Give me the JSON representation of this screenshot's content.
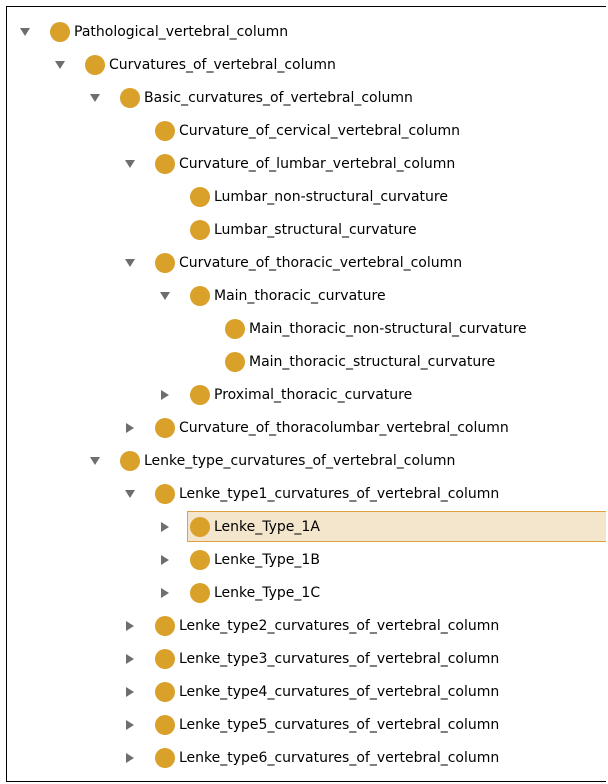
{
  "tree": {
    "colors": {
      "class_dot": "#d9a02a",
      "toggle_arrow": "#6e6e6e",
      "selection_fill": "#f4e6cc",
      "selection_border": "#e0a040"
    },
    "nodes": [
      {
        "label": "Pathological_vertebral_column",
        "depth": 0,
        "toggle": "expanded",
        "icon": "class-circle-icon"
      },
      {
        "label": "Curvatures_of_vertebral_column",
        "depth": 1,
        "toggle": "expanded",
        "icon": "class-circle-icon"
      },
      {
        "label": "Basic_curvatures_of_vertebral_column",
        "depth": 2,
        "toggle": "expanded",
        "icon": "class-circle-icon"
      },
      {
        "label": "Curvature_of_cervical_vertebral_column",
        "depth": 3,
        "toggle": "none",
        "icon": "class-circle-icon"
      },
      {
        "label": "Curvature_of_lumbar_vertebral_column",
        "depth": 3,
        "toggle": "expanded",
        "icon": "class-circle-icon"
      },
      {
        "label": "Lumbar_non-structural_curvature",
        "depth": 4,
        "toggle": "none",
        "icon": "class-circle-icon"
      },
      {
        "label": "Lumbar_structural_curvature",
        "depth": 4,
        "toggle": "none",
        "icon": "class-circle-icon"
      },
      {
        "label": "Curvature_of_thoracic_vertebral_column",
        "depth": 3,
        "toggle": "expanded",
        "icon": "class-circle-icon"
      },
      {
        "label": "Main_thoracic_curvature",
        "depth": 4,
        "toggle": "expanded",
        "icon": "class-circle-icon"
      },
      {
        "label": "Main_thoracic_non-structural_curvature",
        "depth": 5,
        "toggle": "none",
        "icon": "class-circle-icon"
      },
      {
        "label": "Main_thoracic_structural_curvature",
        "depth": 5,
        "toggle": "none",
        "icon": "class-circle-icon"
      },
      {
        "label": "Proximal_thoracic_curvature",
        "depth": 4,
        "toggle": "collapsed",
        "icon": "class-circle-icon"
      },
      {
        "label": "Curvature_of_thoracolumbar_vertebral_column",
        "depth": 3,
        "toggle": "collapsed",
        "icon": "class-circle-icon"
      },
      {
        "label": "Lenke_type_curvatures_of_vertebral_column",
        "depth": 2,
        "toggle": "expanded",
        "icon": "class-circle-icon"
      },
      {
        "label": "Lenke_type1_curvatures_of_vertebral_column",
        "depth": 3,
        "toggle": "expanded",
        "icon": "class-circle-icon"
      },
      {
        "label": "Lenke_Type_1A",
        "depth": 4,
        "toggle": "collapsed",
        "icon": "class-circle-icon",
        "selected": true
      },
      {
        "label": "Lenke_Type_1B",
        "depth": 4,
        "toggle": "collapsed",
        "icon": "class-circle-icon"
      },
      {
        "label": "Lenke_Type_1C",
        "depth": 4,
        "toggle": "collapsed",
        "icon": "class-circle-icon"
      },
      {
        "label": "Lenke_type2_curvatures_of_vertebral_column",
        "depth": 3,
        "toggle": "collapsed",
        "icon": "class-circle-icon"
      },
      {
        "label": "Lenke_type3_curvatures_of_vertebral_column",
        "depth": 3,
        "toggle": "collapsed",
        "icon": "class-circle-icon"
      },
      {
        "label": "Lenke_type4_curvatures_of_vertebral_column",
        "depth": 3,
        "toggle": "collapsed",
        "icon": "class-circle-icon"
      },
      {
        "label": "Lenke_type5_curvatures_of_vertebral_column",
        "depth": 3,
        "toggle": "collapsed",
        "icon": "class-circle-icon"
      },
      {
        "label": "Lenke_type6_curvatures_of_vertebral_column",
        "depth": 3,
        "toggle": "collapsed",
        "icon": "class-circle-icon"
      }
    ]
  }
}
